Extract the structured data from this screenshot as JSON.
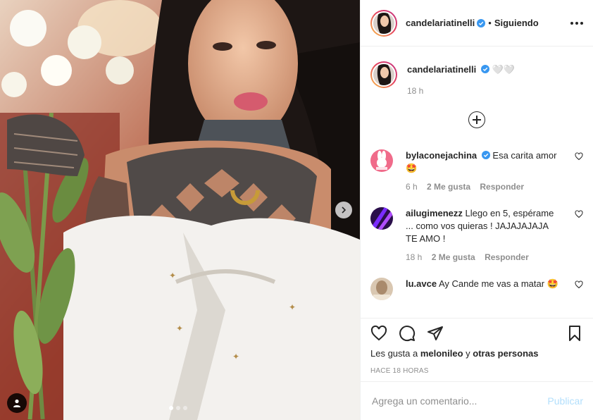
{
  "post": {
    "author": "candelariatinelli",
    "separator": "•",
    "following_label": "Siguiendo",
    "caption_user": "candelariatinelli",
    "caption_text": "🤍🤍",
    "caption_time": "18 h",
    "likes_prefix": "Les gusta a",
    "likes_user": "melonileo",
    "likes_and": "y",
    "likes_others": "otras personas",
    "time_ago": "HACE 18 HORAS",
    "comment_placeholder": "Agrega un comentario...",
    "publish_label": "Publicar"
  },
  "comments": [
    {
      "user": "bylaconejachina",
      "text": "Esa carita amor 🤩",
      "time": "6 h",
      "likes": "2 Me gusta",
      "reply": "Responder"
    },
    {
      "user": "ailugimenezz",
      "text": "Llego en 5, espérame ... como vos quieras ! JAJAJAJAJA TE AMO !",
      "time": "18 h",
      "likes": "2 Me gusta",
      "reply": "Responder"
    },
    {
      "user": "lu.avce",
      "text": "Ay Cande me vas a matar 🤩"
    }
  ]
}
